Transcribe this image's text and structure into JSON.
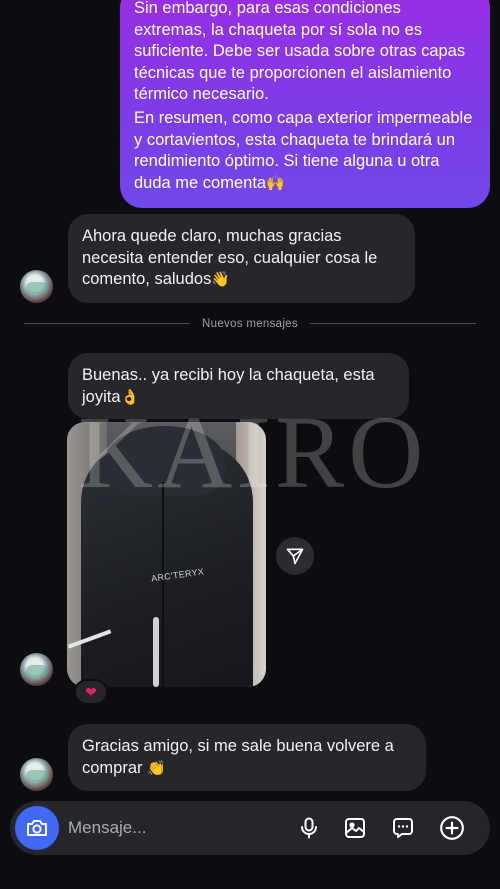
{
  "messages": {
    "outgoing": {
      "p1": "Sin embargo, para esas condiciones extremas, la chaqueta por sí sola no es suficiente. Debe ser usada sobre otras capas técnicas que te proporcionen el aislamiento térmico necesario.",
      "p2": "En resumen, como capa exterior impermeable y cortavientos, esta chaqueta te brindará un rendimiento óptimo. Si tiene alguna u otra duda me comenta",
      "p2_emoji": "🙌"
    },
    "incoming1": {
      "text": "Ahora quede claro, muchas gracias necesita entender eso, cualquier cosa le comento, saludos",
      "emoji": "👋"
    },
    "divider_label": "Nuevos mensajes",
    "incoming2": {
      "text": "Buenas.. ya recibi hoy la chaqueta, esta joyita",
      "emoji": "👌"
    },
    "photo": {
      "brand_text": "ARC'TERYX",
      "watermark": "KAIRO",
      "reaction": "❤"
    },
    "incoming3": {
      "text": "Gracias amigo, si me sale buena volvere a comprar",
      "emoji": "👏"
    }
  },
  "composer": {
    "placeholder": "Mensaje...",
    "icons": [
      "camera-icon",
      "microphone-icon",
      "gallery-icon",
      "sticker-icon",
      "plus-icon"
    ]
  },
  "colors": {
    "background": "#0b0d10",
    "incoming_bubble": "#25272d",
    "outgoing_gradient_top": "#9a2ee3",
    "outgoing_gradient_bottom": "#7148ea",
    "camera_button": "#4169f5"
  }
}
